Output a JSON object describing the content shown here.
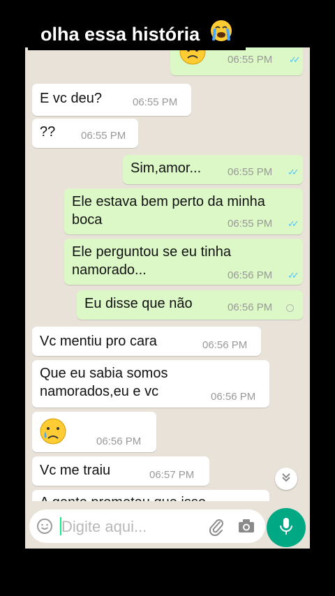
{
  "overlay": {
    "title": "olha essa história"
  },
  "colors": {
    "incoming": "#ffffff",
    "outgoing": "#dcf8c6",
    "wallpaper": "#e8e2d9",
    "accent": "#00a884",
    "read_ticks": "#4fc3f7"
  },
  "messages": [
    {
      "dir": "out",
      "text": "",
      "time": "06:55 PM",
      "status": "read",
      "icon": "frowning-face-emoji"
    },
    {
      "dir": "in",
      "text": "E vc deu?",
      "time": "06:55 PM"
    },
    {
      "dir": "in",
      "text": "??",
      "time": "06:55 PM"
    },
    {
      "dir": "out",
      "text": "Sim,amor...",
      "time": "06:55 PM",
      "status": "read"
    },
    {
      "dir": "out",
      "text": "Ele estava bem perto da minha boca",
      "time": "06:55 PM",
      "status": "read"
    },
    {
      "dir": "out",
      "text": "Ele perguntou se eu tinha namorado...",
      "time": "06:56 PM",
      "status": "read"
    },
    {
      "dir": "out",
      "text": "Eu disse que não",
      "time": "06:56 PM",
      "status": "pending"
    },
    {
      "dir": "in",
      "text": "Vc mentiu pro cara",
      "time": "06:56 PM"
    },
    {
      "dir": "in",
      "text": "Que eu sabia somos namorados,eu e vc",
      "time": "06:56 PM"
    },
    {
      "dir": "in",
      "text": "",
      "time": "06:56 PM",
      "icon": "crying-face-emoji"
    },
    {
      "dir": "in",
      "text": "Vc me traiu",
      "time": "06:57 PM"
    },
    {
      "dir": "in",
      "text": "A gente prometeu que isso",
      "time": ""
    }
  ],
  "input": {
    "placeholder": "Digite aqui..."
  },
  "icons": {
    "emoji": "smiley-icon",
    "attach": "paperclip-icon",
    "camera": "camera-icon",
    "mic": "microphone-icon",
    "scroll": "chevron-double-down-icon"
  }
}
